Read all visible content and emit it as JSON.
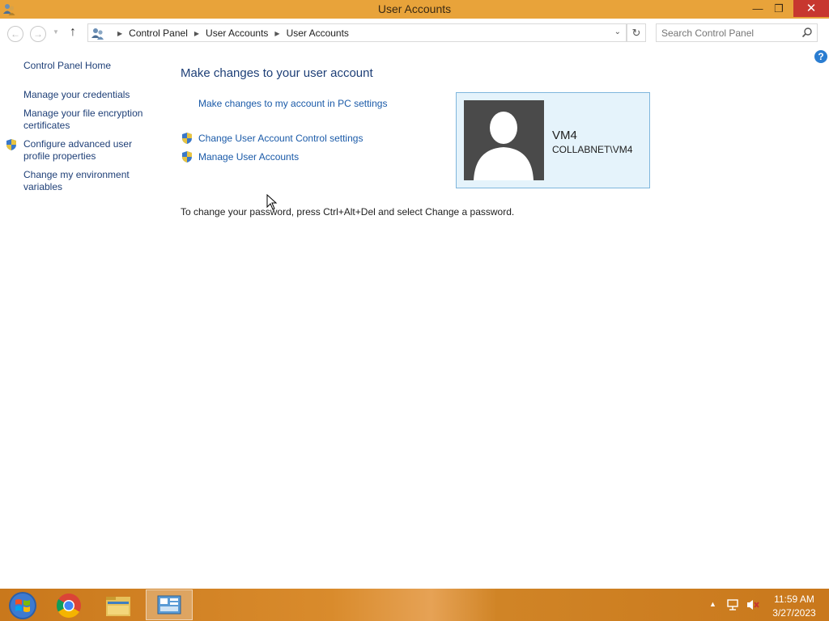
{
  "window": {
    "title": "User Accounts",
    "minimize_glyph": "—",
    "maximize_glyph": "❐",
    "close_glyph": "✕"
  },
  "nav": {
    "back_glyph": "←",
    "forward_glyph": "→",
    "up_glyph": "↑",
    "breadcrumbs": [
      "Control Panel",
      "User Accounts",
      "User Accounts"
    ],
    "refresh_glyph": "↻",
    "search_placeholder": "Search Control Panel",
    "help_glyph": "?"
  },
  "sidebar": {
    "items": [
      {
        "label": "Control Panel Home"
      },
      {
        "label": "Manage your credentials"
      },
      {
        "label": "Manage your file encryption certificates"
      },
      {
        "label": "Configure advanced user profile properties"
      },
      {
        "label": "Change my environment variables"
      }
    ]
  },
  "main": {
    "heading": "Make changes to your user account",
    "links": [
      {
        "label": "Make changes to my account in PC settings"
      },
      {
        "label": "Change User Account Control settings"
      },
      {
        "label": "Manage User Accounts"
      }
    ],
    "password_note": "To change your password, press Ctrl+Alt+Del and select Change a password."
  },
  "account": {
    "name": "VM4",
    "domain": "COLLABNET\\VM4"
  },
  "taskbar": {
    "time": "11:59 AM",
    "date": "3/27/2023"
  },
  "colors": {
    "accent": "#e8a33a",
    "link": "#1a5aa8",
    "tile_background": "#e5f3fb"
  }
}
